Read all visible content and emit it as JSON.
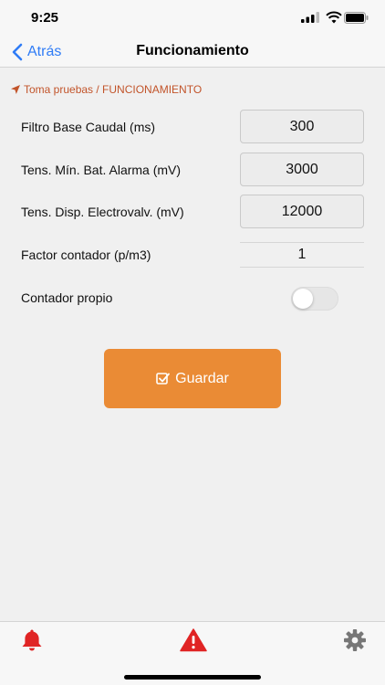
{
  "status_bar": {
    "time": "9:25"
  },
  "nav": {
    "back_label": "Atrás",
    "title": "Funcionamiento"
  },
  "breadcrumb": {
    "text": "Toma pruebas / FUNCIONAMIENTO"
  },
  "form": {
    "rows": [
      {
        "label": "Filtro Base Caudal (ms)",
        "value": "300"
      },
      {
        "label": "Tens. Mín. Bat. Alarma (mV)",
        "value": "3000"
      },
      {
        "label": "Tens. Disp. Electrovalv. (mV)",
        "value": "12000"
      },
      {
        "label": "Factor contador (p/m3)",
        "value": "1"
      }
    ],
    "toggle": {
      "label": "Contador propio",
      "on": false
    }
  },
  "actions": {
    "save_label": "Guardar"
  },
  "tab_bar": {
    "items": [
      {
        "icon": "bell-icon"
      },
      {
        "icon": "alert-triangle-icon"
      },
      {
        "icon": "gear-icon"
      }
    ]
  },
  "colors": {
    "accent_orange": "#ea8b35",
    "breadcrumb": "#c2542a",
    "link_blue": "#2f7cf6",
    "alert_red": "#e02424",
    "settings_gray": "#777777"
  }
}
